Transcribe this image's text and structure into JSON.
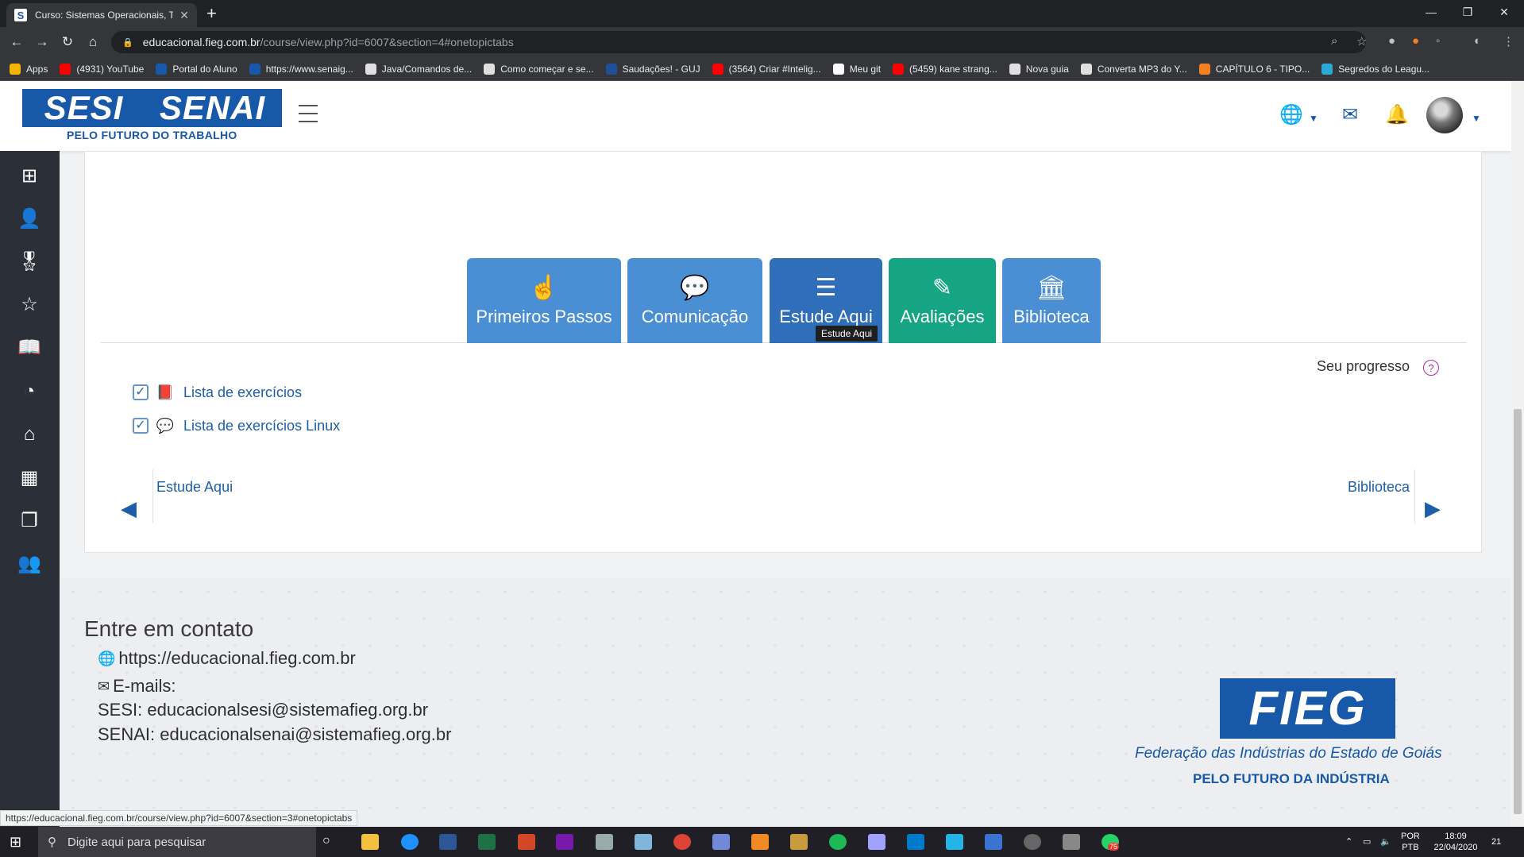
{
  "browser": {
    "tab_title": "Curso: Sistemas Operacionais, To",
    "tab_favicon": "S",
    "url_host": "educacional.fieg.com.br",
    "url_path": "/course/view.php?id=6007&section=4#onetopictabs",
    "status_url": "https://educacional.fieg.com.br/course/view.php?id=6007&section=3#onetopictabs"
  },
  "bookmarks": [
    {
      "label": "Apps",
      "icon": "apps-grid-icon",
      "color": "#f4b400"
    },
    {
      "label": "(4931) YouTube",
      "icon": "youtube-icon",
      "color": "#ff0000"
    },
    {
      "label": "Portal do Aluno",
      "icon": "portal-icon",
      "color": "#1858a8"
    },
    {
      "label": "https://www.senaig...",
      "icon": "senai-icon",
      "color": "#1858a8"
    },
    {
      "label": "Java/Comandos de...",
      "icon": "java-icon",
      "color": "#e0e0e0"
    },
    {
      "label": "Como começar e se...",
      "icon": "leaf-icon",
      "color": "#e0e0e0"
    },
    {
      "label": "Saudações! - GUJ",
      "icon": "guj-icon",
      "color": "#1f4e9a"
    },
    {
      "label": "(3564) Criar #Intelig...",
      "icon": "youtube-icon",
      "color": "#ff0000"
    },
    {
      "label": "Meu git",
      "icon": "github-icon",
      "color": "#ffffff"
    },
    {
      "label": "(5459) kane strang...",
      "icon": "youtube-icon",
      "color": "#ff0000"
    },
    {
      "label": "Nova guia",
      "icon": "globe-icon",
      "color": "#e0e0e0"
    },
    {
      "label": "Converta MP3 do Y...",
      "icon": "globe-icon",
      "color": "#e0e0e0"
    },
    {
      "label": "CAPÍTULO 6 - TIPO...",
      "icon": "stack-icon",
      "color": "#f48024"
    },
    {
      "label": "Segredos do Leagu...",
      "icon": "league-icon",
      "color": "#2aa9d6"
    }
  ],
  "header": {
    "logo_left": "SESI",
    "logo_right": "SENAI",
    "logo_tagline": "PELO FUTURO DO TRABALHO"
  },
  "course_tabs": [
    {
      "label": "Primeiros Passos",
      "icon": "hand-pointer-icon",
      "color": "#4a8fd4"
    },
    {
      "label": "Comunicação",
      "icon": "chat-bubbles-icon",
      "color": "#4a8fd4"
    },
    {
      "label": "Estude Aqui",
      "icon": "list-icon",
      "color": "#2f6eb8"
    },
    {
      "label": "Avaliações",
      "icon": "edit-icon",
      "color": "#15a583"
    },
    {
      "label": "Biblioteca",
      "icon": "library-icon",
      "color": "#4a8fd4"
    }
  ],
  "tooltip": "Estude Aqui",
  "progress_label": "Seu progresso",
  "activities": [
    {
      "label": "Lista de exercícios",
      "icon": "pdf-icon",
      "checked": "✓"
    },
    {
      "label": "Lista de exercícios Linux",
      "icon": "forum-icon",
      "checked": "✓"
    }
  ],
  "section_nav": {
    "prev": "Estude Aqui",
    "next": "Biblioteca"
  },
  "footer": {
    "title": "Entre em contato",
    "site": "https://educacional.fieg.com.br",
    "emails_label": "E-mails:",
    "sesi_email": "SESI: educacionalsesi@sistemafieg.org.br",
    "senai_email": "SENAI: educacionalsenai@sistemafieg.org.br",
    "fieg_logo": "FIEG",
    "fieg_name": "Federação das Indústrias do Estado de Goiás",
    "fieg_tagline": "PELO FUTURO DA INDÚSTRIA"
  },
  "taskbar": {
    "search_placeholder": "Digite aqui para pesquisar",
    "lang_top": "POR",
    "lang_bottom": "PTB",
    "time": "18:09",
    "date": "22/04/2020",
    "notifications": "21",
    "whatsapp_badge": "75"
  },
  "colors": {
    "brand": "#1858a8",
    "sidebar": "#2b3038",
    "link": "#1d5fa6",
    "active_tab": "#2f6eb8",
    "green_tab": "#15a583"
  }
}
